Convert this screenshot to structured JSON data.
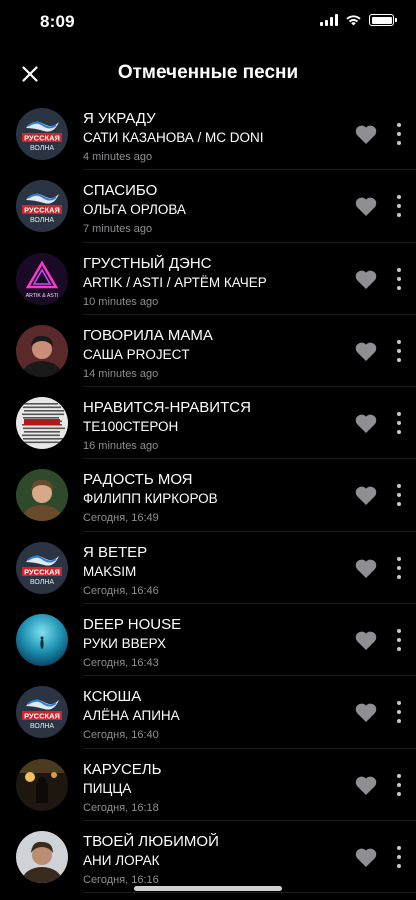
{
  "status_bar": {
    "time": "8:09"
  },
  "header": {
    "title": "Отмеченные песни"
  },
  "colors": {
    "background": "#000000",
    "secondary_text": "#8e8e93",
    "icon_gray": "#8e8e93"
  },
  "songs": [
    {
      "title": "Я УКРАДУ",
      "artist": "САТИ КАЗАНОВА / MC DONI",
      "time": "4 minutes ago",
      "cover": "russkaya-volna-logo"
    },
    {
      "title": "СПАСИБО",
      "artist": "ОЛЬГА ОРЛОВА",
      "time": "7 minutes ago",
      "cover": "russkaya-volna-logo"
    },
    {
      "title": "ГРУСТНЫЙ ДЭНС",
      "artist": "ARTIK / ASTI / АРТЁМ КАЧЕР",
      "time": "10 minutes ago",
      "cover": "artik-asti-logo",
      "cover_text": "ARTIK & ASTI"
    },
    {
      "title": "ГОВОРИЛА МАМА",
      "artist": "САША PROJECT",
      "time": "14 minutes ago",
      "cover": "artist-photo"
    },
    {
      "title": "НРАВИТСЯ-НРАВИТСЯ",
      "artist": "ТЕ100СТЕРОН",
      "time": "16 minutes ago",
      "cover": "text-poster"
    },
    {
      "title": "РАДОСТЬ МОЯ",
      "artist": "ФИЛИПП КИРКОРОВ",
      "time": "Сегодня, 16:49",
      "cover": "artist-photo"
    },
    {
      "title": "Я ВЕТЕР",
      "artist": "MAKSIM",
      "time": "Сегодня, 16:46",
      "cover": "russkaya-volna-logo"
    },
    {
      "title": "DEEP HOUSE",
      "artist": "РУКИ ВВЕРХ",
      "time": "Сегодня, 16:43",
      "cover": "underwater-photo"
    },
    {
      "title": "КСЮША",
      "artist": "АЛЁНА АПИНА",
      "time": "Сегодня, 16:40",
      "cover": "russkaya-volna-logo"
    },
    {
      "title": "КАРУСЕЛЬ",
      "artist": "ПИЦЦА",
      "time": "Сегодня, 16:18",
      "cover": "stage-photo"
    },
    {
      "title": "ТВОЕЙ ЛЮБИМОЙ",
      "artist": "АНИ ЛОРАК",
      "time": "Сегодня, 16:16",
      "cover": "artist-photo"
    }
  ]
}
